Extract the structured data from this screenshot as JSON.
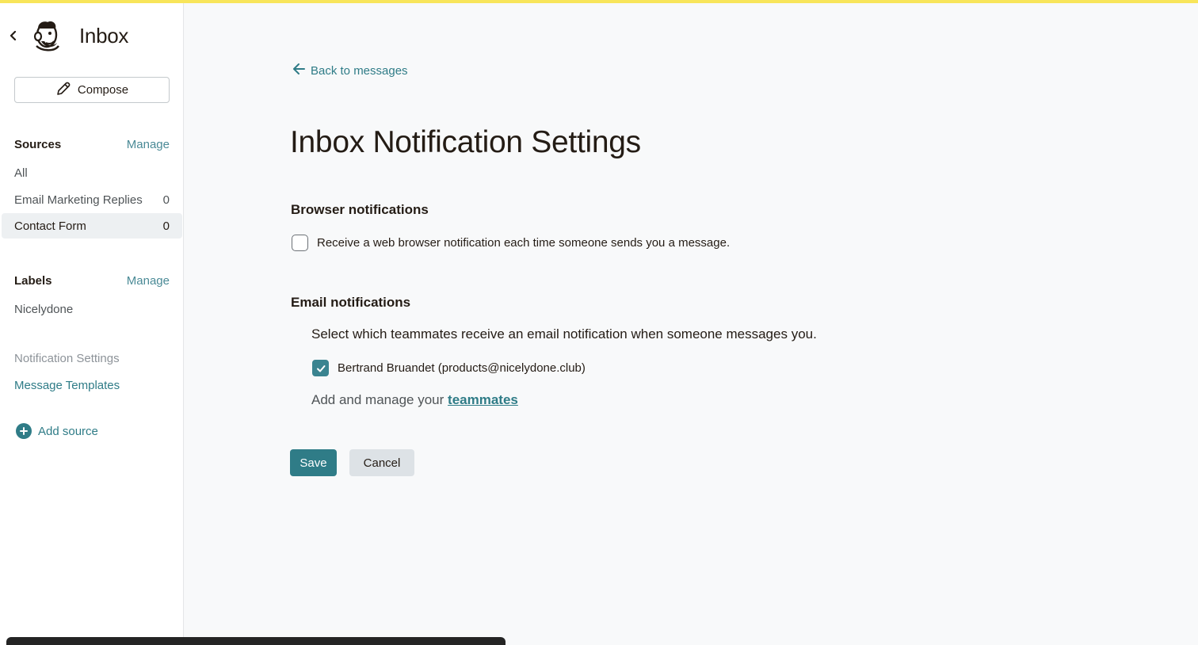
{
  "sidebar": {
    "title": "Inbox",
    "compose_label": "Compose",
    "sources": {
      "heading": "Sources",
      "manage_label": "Manage",
      "items": [
        {
          "label": "All",
          "count": ""
        },
        {
          "label": "Email Marketing Replies",
          "count": "0"
        },
        {
          "label": "Contact Form",
          "count": "0"
        }
      ]
    },
    "labels": {
      "heading": "Labels",
      "manage_label": "Manage",
      "items": [
        {
          "label": "Nicelydone"
        }
      ]
    },
    "links": {
      "notification_settings": "Notification Settings",
      "message_templates": "Message Templates"
    },
    "add_source_label": "Add source"
  },
  "main": {
    "back_label": "Back to messages",
    "title": "Inbox Notification Settings",
    "browser": {
      "heading": "Browser notifications",
      "checkbox_label": "Receive a web browser notification each time someone sends you a message.",
      "checked": false
    },
    "email": {
      "heading": "Email notifications",
      "description": "Select which teammates receive an email notification when someone messages you.",
      "teammates": [
        {
          "label": "Bertrand Bruandet (products@nicelydone.club)",
          "checked": true
        }
      ],
      "manage_prefix": "Add and manage your",
      "manage_link": "teammates"
    },
    "save_label": "Save",
    "cancel_label": "Cancel"
  },
  "colors": {
    "accent": "#2f7c87",
    "top_bar": "#f8e55a",
    "background": "#f8f9fa"
  }
}
